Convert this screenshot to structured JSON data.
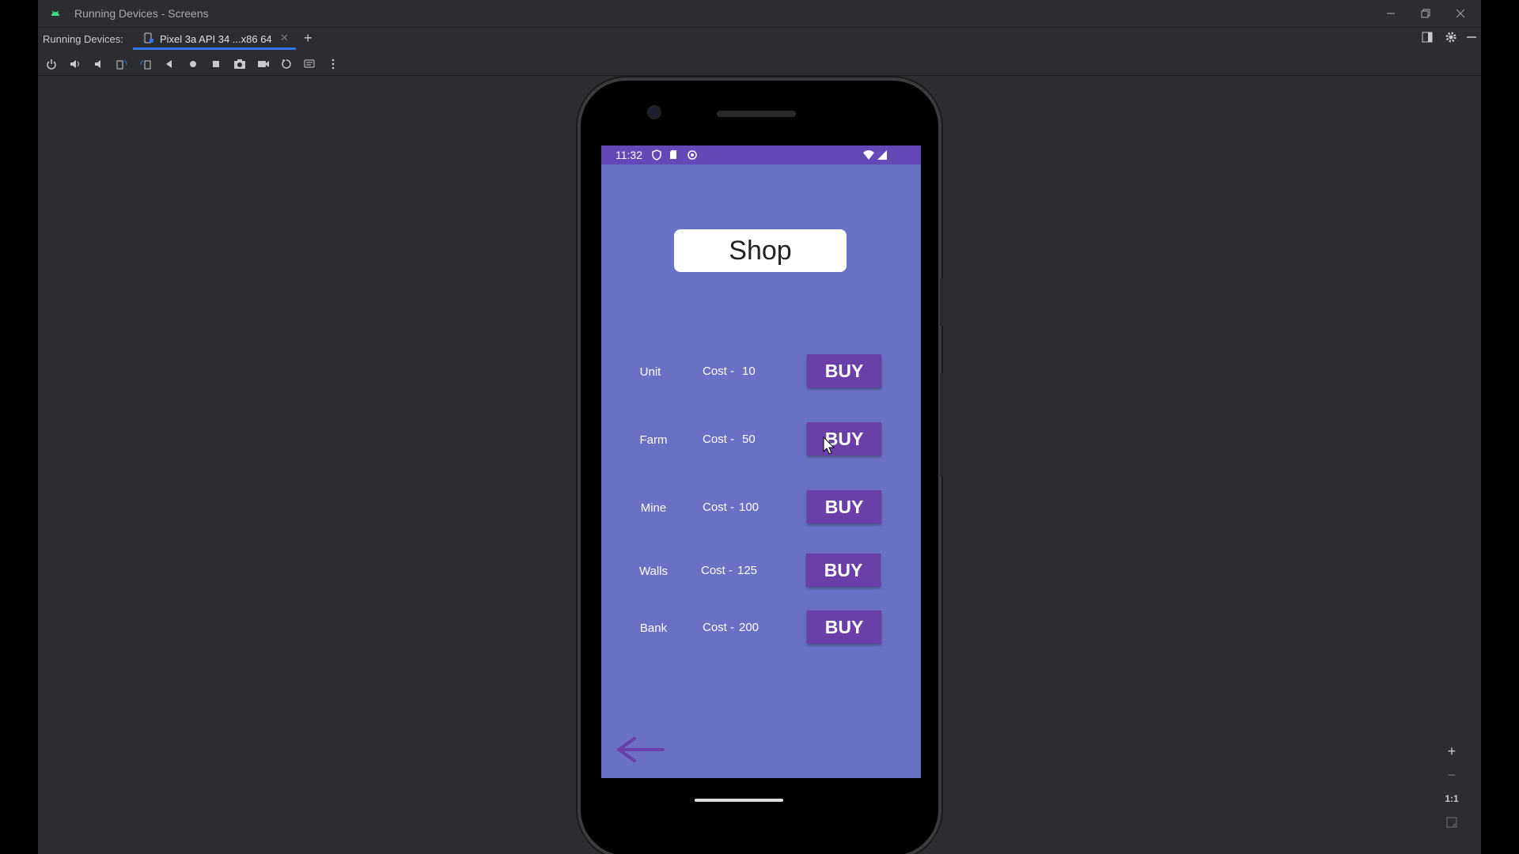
{
  "window": {
    "title": "Running Devices - Screens"
  },
  "tabbar": {
    "label": "Running Devices:",
    "tab_label": "Pixel 3a API 34 ...x86 64",
    "add_symbol": "+"
  },
  "toolbar": {
    "icons": [
      "power-icon",
      "volume-up-icon",
      "volume-down-icon",
      "rotate-left-icon",
      "rotate-right-icon",
      "back-icon",
      "home-icon",
      "overview-icon",
      "screenshot-icon",
      "record-icon",
      "reset-icon",
      "extended-controls-icon",
      "more-icon"
    ]
  },
  "device": {
    "status_time": "11:32",
    "shop_title": "Shop",
    "items": [
      {
        "name": "Unit",
        "cost_label": "Cost -",
        "cost": "10",
        "button": "BUY"
      },
      {
        "name": "Farm",
        "cost_label": "Cost -",
        "cost": "50",
        "button": "BUY"
      },
      {
        "name": "Mine",
        "cost_label": "Cost -",
        "cost": "100",
        "button": "BUY"
      },
      {
        "name": "Walls",
        "cost_label": "Cost -",
        "cost": "125",
        "button": "BUY"
      },
      {
        "name": "Bank",
        "cost_label": "Cost -",
        "cost": "200",
        "button": "BUY"
      }
    ]
  },
  "zoom": {
    "zoom_in": "+",
    "zoom_out": "−",
    "actual_size": "1:1"
  },
  "colors": {
    "app_background": "#6a70c4",
    "status_bar": "#6448b6",
    "buy_button": "#6b3fa8",
    "back_arrow": "#6b3fa8"
  }
}
